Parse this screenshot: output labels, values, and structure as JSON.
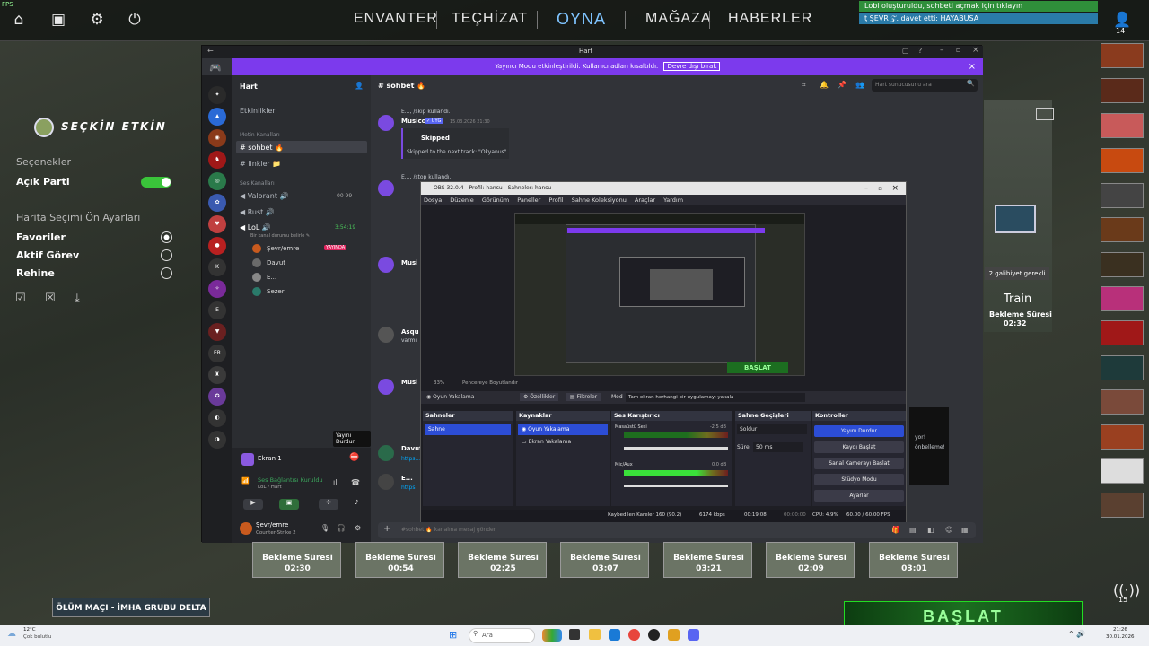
{
  "fps": "FPS",
  "nav": [
    "ENVANTER",
    "TEÇHİZAT",
    "OYNA",
    "MAĞAZA",
    "HABERLER"
  ],
  "notifications": [
    "Lobi oluşturuldu, sohbeti açmak için tıklayın",
    "ţ ŞEVR 𝒵. davet etti: HAYABUSA"
  ],
  "friend_count": "14",
  "left": {
    "title": "SEÇKİN ETKİN",
    "options_header": "Seçenekler",
    "open_party": "Açık Parti",
    "map_header": "Harita Seçimi Ön Ayarları",
    "favorites": "Favoriler",
    "active": "Aktif Görev",
    "reserve": "Rehine"
  },
  "right_map": {
    "badge": "2 galibiyet gerekli",
    "name": "Train",
    "wait": "Bekleme Süresi",
    "time": "02:32"
  },
  "discord": {
    "title": "Hart",
    "banner": "Yayıncı Modu etkinleştirildi. Kullanıcı adları kısaltıldı.",
    "banner_btn": "Devre dışı bırak",
    "server": "Hart",
    "events": "Etkinlikler",
    "text_cat": "Metin Kanalları",
    "ch1": "sohbet 🔥",
    "ch2": "linkler 📁",
    "voice_cat": "Ses Kanalları",
    "v1": "Valorant 🔊",
    "v1c": "00  99",
    "v2": "Rust 🔊",
    "v3": "LoL 🔊",
    "v3t": "3:54:19",
    "v3sub": "Bir kanal durumu belirle ✎",
    "users": [
      "Şevr/emre",
      "Davut",
      "E...",
      "Sezer"
    ],
    "live": "YAYINDA",
    "screen": "Ekran 1",
    "tooltip": "Yayını Durdur",
    "conn": "Ses Bağlantısı Kuruldu",
    "conn_sub": "LoL / Hart",
    "me": "Şevr/emre",
    "me_sub": "Counter-Strike 2",
    "chat_channel": "sohbet 🔥",
    "search": "Hart sunucusunu ara",
    "msg1_top": "E..., /skip kullandı.",
    "msg1_name": "Musico",
    "msg1_bot": "✓ UYG",
    "msg1_time": "15.03.2026 21:30",
    "msg1_title": "Skipped",
    "msg1_txt": "Skipped to the next track: \"Okyanus\"",
    "msg2_top": "E..., /stop kullandı.",
    "msg3": "Musi",
    "msg4": "Musi",
    "msg5_name": "Asqu",
    "msg5_txt": "varmı",
    "msg6": "Musi",
    "msg7_name": "Davut",
    "msg7_txt": "https...",
    "msg8_name": "E...",
    "msg8_txt": "https",
    "input": "#sohbet 🔥 kanalına mesaj gönder",
    "side_txt1": "yor!",
    "side_txt2": "önbelleme!"
  },
  "obs": {
    "title": "OBS 32.0.4 - Profil: hansu - Sahneler: hansu",
    "menu": [
      "Dosya",
      "Düzenle",
      "Görünüm",
      "Paneller",
      "Profil",
      "Sahne Koleksiyonu",
      "Araçlar",
      "Yardım"
    ],
    "zoom": "33%",
    "fit": "Pencereye Boyutlandır",
    "source_label": "Oyun Yakalama",
    "props": "Özellikler",
    "filters": "Filtreler",
    "mode": "Mod",
    "mode_val": "Tam ekran herhangi bir uygulamayı yakala",
    "scenes_hdr": "Sahneler",
    "scene1": "Sahne",
    "sources_hdr": "Kaynaklar",
    "src1": "Oyun Yakalama",
    "src2": "Ekran Yakalama",
    "mixer_hdr": "Ses Karıştırıcı",
    "mix1": "Masaüstü Sesi",
    "mix1_db": "-2.5 dB",
    "mix2": "Mic/Aux",
    "mix2_db": "0.0 dB",
    "trans_hdr": "Sahne Geçişleri",
    "trans_val": "Soldur",
    "dur_label": "Süre",
    "dur_val": "50 ms",
    "ctrl_hdr": "Kontroller",
    "ctrl": [
      "Yayını Durdur",
      "Kaydı Başlat",
      "Sanal Kamerayı Başlat",
      "Stüdyo Modu",
      "Ayarlar"
    ],
    "status_drop": "Kaybedilen Kareler 160 (90.2)",
    "status_kbps": "6174 kbps",
    "status_t1": "00:19:08",
    "status_t2": "00:00:00",
    "status_cpu": "CPU: 4.9%",
    "status_fps": "60.00 / 60.00 FPS",
    "preview_start": "BAŞLAT"
  },
  "maps": [
    {
      "wait": "Bekleme Süresi",
      "time": "02:30"
    },
    {
      "wait": "Bekleme Süresi",
      "time": "00:54"
    },
    {
      "wait": "Bekleme Süresi",
      "time": "02:25"
    },
    {
      "wait": "Bekleme Süresi",
      "time": "03:07"
    },
    {
      "wait": "Bekleme Süresi",
      "time": "03:21"
    },
    {
      "wait": "Bekleme Süresi",
      "time": "02:09"
    },
    {
      "wait": "Bekleme Süresi",
      "time": "03:01"
    }
  ],
  "mode_banner": "ÖLÜM MAÇI - İMHA GRUBU DELTA",
  "start": "BAŞLAT",
  "signal_count": "15",
  "taskbar": {
    "weather_temp": "12°C",
    "weather_txt": "Çok bulutlu",
    "search": "Ara",
    "time": "21:26",
    "date": "30.01.2026"
  },
  "colors": {
    "accent_purple": "#7c3aed",
    "obs_blue": "#2c4dd6",
    "toggle_green": "#3ac43a",
    "live_red": "#e0245e"
  }
}
